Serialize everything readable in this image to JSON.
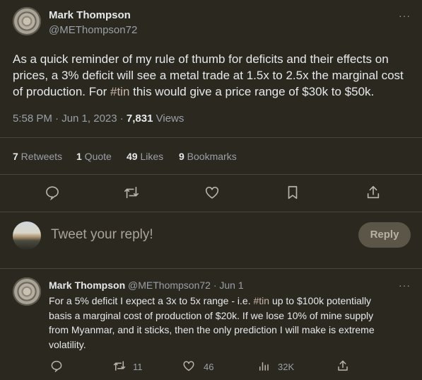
{
  "main_tweet": {
    "author_name": "Mark Thompson",
    "author_handle": "@METhompson72",
    "more": "···",
    "text_line1": "As a quick reminder of my rule of thumb for deficits and their effects on",
    "text_line2": "prices, a 3% deficit will see a metal trade at 1.5x to 2.5x the marginal cost",
    "text_line3": "of production. For",
    "hashtag": "#tin",
    "text_line3_rest": " this would give a price range of $30k to $50k.",
    "time": "5:58 PM · Jun 1, 2023 · ",
    "views_count": "7,831",
    "views_label": " Views"
  },
  "stats": {
    "retweets_count": "7",
    "retweets_label": " Retweets",
    "quotes_count": "1",
    "quotes_label": " Quote",
    "likes_count": "49",
    "likes_label": " Likes",
    "bookmarks_count": "9",
    "bookmarks_label": " Bookmarks"
  },
  "reply_box": {
    "placeholder": "Tweet your reply!",
    "button_label": "Reply"
  },
  "reply_tweet": {
    "author_name": "Mark Thompson",
    "author_handle": "@METhompson72 · Jun 1",
    "more": "···",
    "line1_pre": "For a 5% deficit I expect a 3x to 5x range - i.e. ",
    "hashtag": "#tin",
    "line1_post": " up to $100k potentially",
    "line2": "basis a marginal cost of production of $20k. If we lose 10% of mine supply",
    "line3": "from Myanmar, and it sticks, then the only prediction I will make is extreme",
    "line4": "volatility.",
    "retweets": "11",
    "likes": "46",
    "views": "32K"
  },
  "icons": [
    "reply-icon",
    "retweet-icon",
    "like-icon",
    "bookmark-icon",
    "share-icon",
    "views-icon"
  ]
}
